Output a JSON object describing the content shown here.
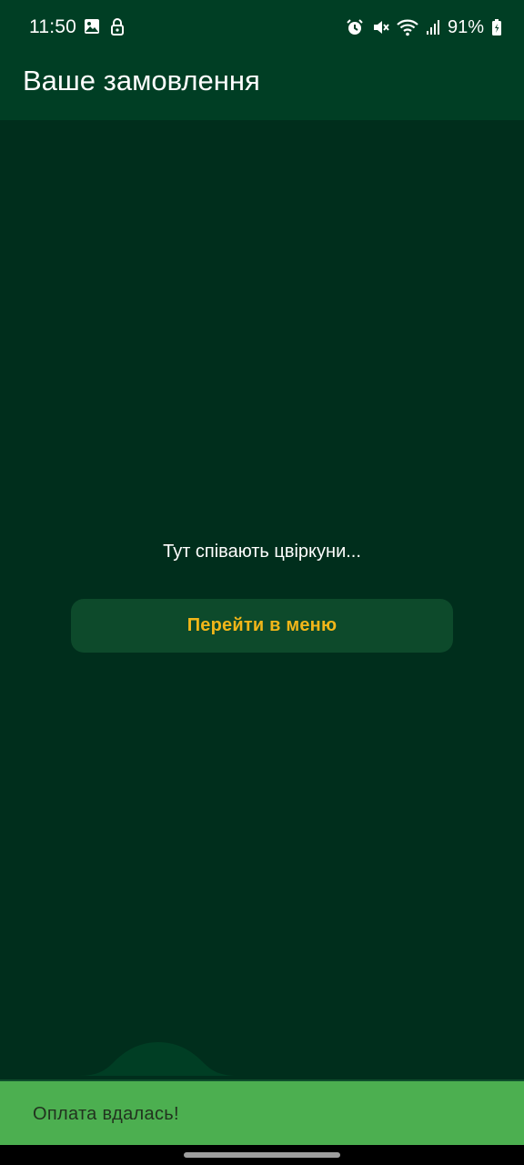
{
  "status_bar": {
    "time": "11:50",
    "battery": "91%",
    "left_icons": [
      "image-icon",
      "lock-icon"
    ],
    "right_icons": [
      "alarm-icon",
      "mute-icon",
      "wifi-icon",
      "signal-icon",
      "battery-icon"
    ]
  },
  "app_bar": {
    "title": "Ваше замовлення"
  },
  "empty_state": {
    "message": "Тут співають цвіркуни...",
    "button_label": "Перейти в меню"
  },
  "snackbar": {
    "message": "Оплата вдалась!"
  },
  "colors": {
    "background": "#002e1c",
    "app_bar": "#003e24",
    "button_bg": "#0d4a2b",
    "button_text": "#f2b619",
    "snackbar_bg": "#4caf50",
    "snackbar_text": "#22331f"
  }
}
